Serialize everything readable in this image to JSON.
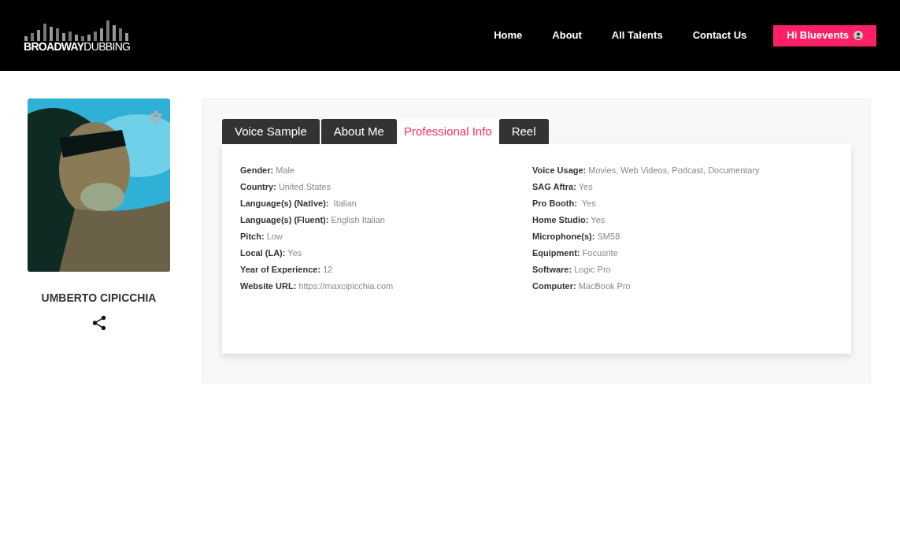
{
  "header": {
    "logo_text": "**BROADWAY**DUBBING",
    "nav": [
      {
        "label": "Home",
        "kind": "link"
      },
      {
        "label": "About",
        "kind": "link"
      },
      {
        "label": "All Talents",
        "kind": "link"
      },
      {
        "label": "Contact Us",
        "kind": "link"
      },
      {
        "label": "Hi Bluevents",
        "kind": "account"
      }
    ]
  },
  "profile": {
    "name": "UMBERTO CIPICCHIA"
  },
  "tabs": [
    {
      "label": "Voice Sample",
      "selected": false
    },
    {
      "label": "About Me",
      "selected": false
    },
    {
      "label": "Professional Info",
      "selected": true
    },
    {
      "label": "Reel",
      "selected": false
    }
  ],
  "info_columns": [
    [
      {
        "label": "Gender:",
        "value": "Male"
      },
      {
        "label": "Country:",
        "value": "United States"
      },
      {
        "label": "Language(s) (Native):",
        "value": " Italian"
      },
      {
        "label": "Language(s) (Fluent):",
        "value": "English Italian"
      },
      {
        "label": "Pitch:",
        "value": "Low"
      },
      {
        "label": "Local (LA):",
        "value": "Yes"
      },
      {
        "label": "Year of Experience:",
        "value": "12"
      },
      {
        "label": "Website URL:",
        "value": "https://maxcipicchia.com"
      }
    ],
    [
      {
        "label": "Voice Usage:",
        "value": "Movies, Web Videos, Podcast, Documentary"
      },
      {
        "label": "SAG Aftra:",
        "value": "Yes"
      },
      {
        "label": "Pro Booth:",
        "value": " Yes"
      },
      {
        "label": "Home Studio:",
        "value": "Yes"
      },
      {
        "label": "Microphone(s):",
        "value": "SM58"
      },
      {
        "label": "Equipment:",
        "value": "Focusrite"
      },
      {
        "label": "Software:",
        "value": "Logic Pro"
      },
      {
        "label": "Computer:",
        "value": "MacBook Pro"
      }
    ]
  ]
}
